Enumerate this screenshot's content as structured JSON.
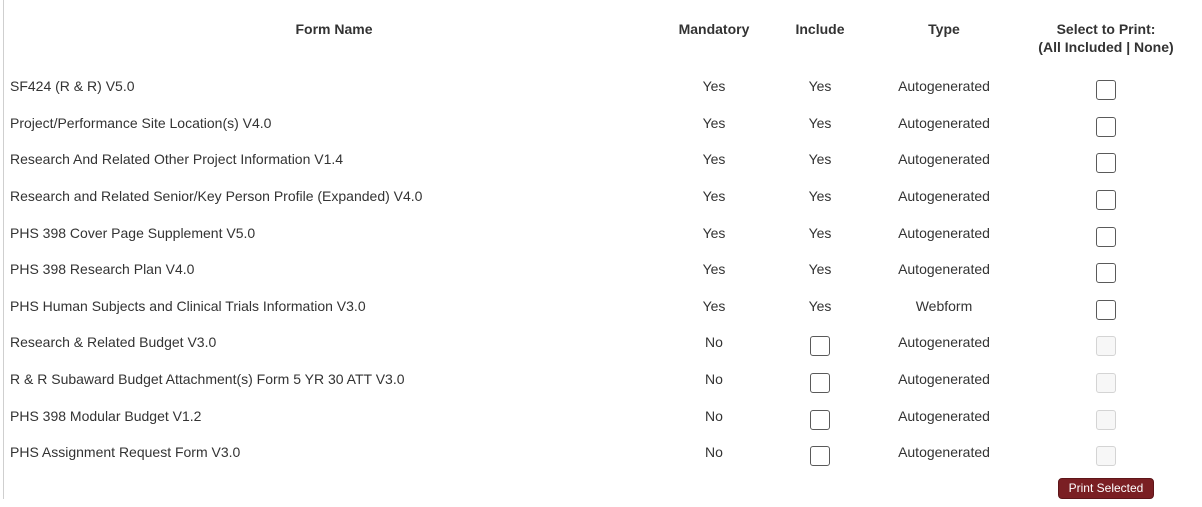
{
  "table": {
    "headers": {
      "form_name": "Form Name",
      "mandatory": "Mandatory",
      "include": "Include",
      "type": "Type",
      "select_line1": "Select to Print:",
      "select_open": "(",
      "all_included": "All Included",
      "separator": " | ",
      "none": "None",
      "select_close": ")"
    },
    "rows": [
      {
        "name": "SF424 (R & R) V5.0",
        "mandatory": "Yes",
        "include": "Yes",
        "type": "Autogenerated"
      },
      {
        "name": "Project/Performance Site Location(s) V4.0",
        "mandatory": "Yes",
        "include": "Yes",
        "type": "Autogenerated"
      },
      {
        "name": "Research And Related Other Project Information V1.4",
        "mandatory": "Yes",
        "include": "Yes",
        "type": "Autogenerated"
      },
      {
        "name": "Research and Related Senior/Key Person Profile (Expanded) V4.0",
        "mandatory": "Yes",
        "include": "Yes",
        "type": "Autogenerated"
      },
      {
        "name": "PHS 398 Cover Page Supplement V5.0",
        "mandatory": "Yes",
        "include": "Yes",
        "type": "Autogenerated"
      },
      {
        "name": "PHS 398 Research Plan V4.0",
        "mandatory": "Yes",
        "include": "Yes",
        "type": "Autogenerated"
      },
      {
        "name": "PHS Human Subjects and Clinical Trials Information V3.0",
        "mandatory": "Yes",
        "include": "Yes",
        "type": "Webform"
      },
      {
        "name": "Research & Related Budget V3.0",
        "mandatory": "No",
        "include": "",
        "type": "Autogenerated"
      },
      {
        "name": "R & R Subaward Budget Attachment(s) Form 5 YR 30 ATT V3.0",
        "mandatory": "No",
        "include": "",
        "type": "Autogenerated"
      },
      {
        "name": "PHS 398 Modular Budget V1.2",
        "mandatory": "No",
        "include": "",
        "type": "Autogenerated"
      },
      {
        "name": "PHS Assignment Request Form V3.0",
        "mandatory": "No",
        "include": "",
        "type": "Autogenerated"
      }
    ]
  },
  "actions": {
    "print_selected_label": "Print Selected"
  }
}
